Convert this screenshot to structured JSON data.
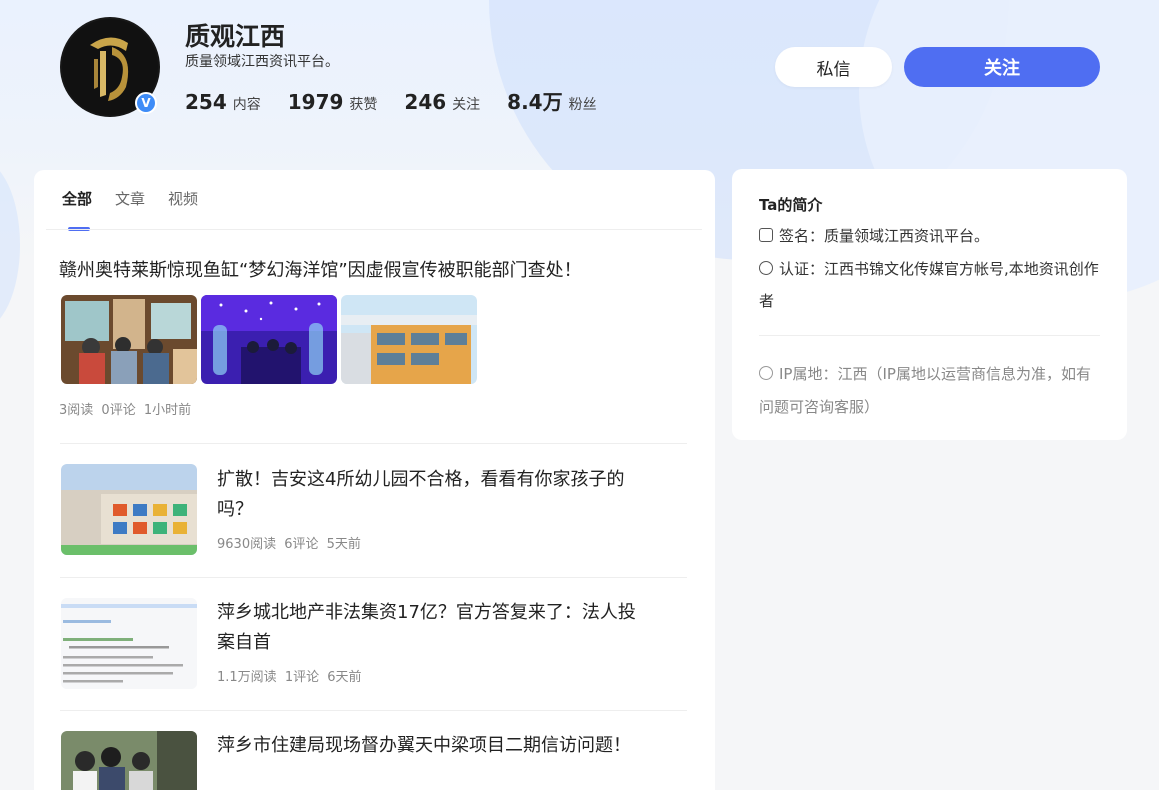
{
  "profile": {
    "name": "质观江西",
    "bio": "质量领域江西资讯平台。",
    "verified_mark": "V",
    "stats": [
      {
        "num": "254",
        "label": "内容"
      },
      {
        "num": "1979",
        "label": "获赞"
      },
      {
        "num": "246",
        "label": "关注"
      },
      {
        "num": "8.4万",
        "label": "粉丝"
      }
    ]
  },
  "actions": {
    "message_label": "私信",
    "follow_label": "关注"
  },
  "tabs": [
    {
      "label": "全部",
      "active": true
    },
    {
      "label": "文章",
      "active": false
    },
    {
      "label": "视频",
      "active": false
    }
  ],
  "feed": {
    "featured": {
      "title": "赣州奥特莱斯惊现鱼缸“梦幻海洋馆”因虚假宣传被职能部门查处！",
      "reads": "3阅读",
      "comments": "0评论",
      "time": "1小时前"
    },
    "items": [
      {
        "title": "扩散！吉安这4所幼儿园不合格，看看有你家孩子的吗？",
        "reads": "9630阅读",
        "comments": "6评论",
        "time": "5天前"
      },
      {
        "title": "萍乡城北地产非法集资17亿？官方答复来了：法人投案自首",
        "reads": "1.1万阅读",
        "comments": "1评论",
        "time": "6天前"
      },
      {
        "title": "萍乡市住建局现场督办翼天中梁项目二期信访问题！",
        "reads": "",
        "comments": "",
        "time": ""
      }
    ]
  },
  "sidebar": {
    "title": "Ta的简介",
    "signature": "签名：质量领域江西资讯平台。",
    "certification": "认证：江西书锦文化传媒官方帐号,本地资讯创作者",
    "ip": "IP属地：江西（IP属地以运营商信息为准，如有问题可咨询客服）"
  },
  "colors": {
    "accent": "#4f6ef2",
    "verified": "#3e8cf7"
  },
  "icons": [
    "verified-badge-icon",
    "signature-icon",
    "certification-icon",
    "info-icon"
  ]
}
